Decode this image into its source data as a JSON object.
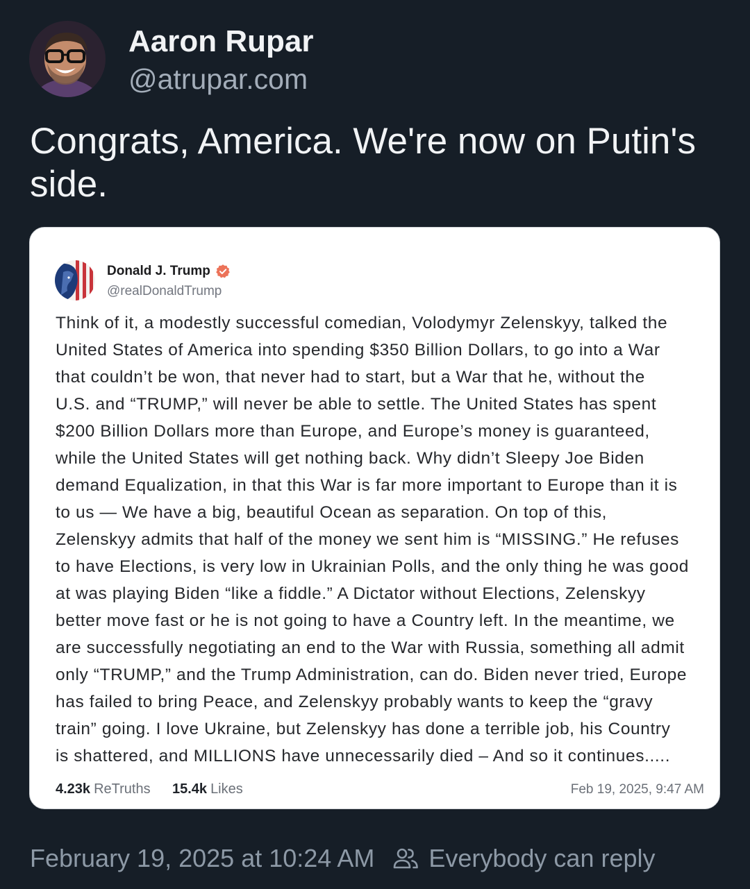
{
  "post": {
    "author_name": "Aaron Rupar",
    "author_handle": "@atrupar.com",
    "text": "Congrats, America. We're now on Putin's side.",
    "timestamp": "February 19, 2025 at 10:24 AM",
    "reply_setting": "Everybody can reply"
  },
  "embedded_screenshot": {
    "author_name": "Donald J. Trump",
    "author_handle": "@realDonaldTrump",
    "verified": true,
    "body_lines": [
      "Think of it, a modestly successful comedian, Volodymyr Zelenskyy, talked the",
      "United States of America into spending $350 Billion Dollars, to go into a War",
      "that couldn’t be won, that never had to start, but a War that he, without the",
      "U.S. and “TRUMP,” will never be able to settle. The United States has spent",
      "$200 Billion Dollars more than Europe, and Europe’s money is guaranteed,",
      "while the United States will get nothing back. Why didn’t Sleepy Joe Biden",
      "demand Equalization, in that this War is far more important to Europe than it is",
      "to us — We have a big, beautiful Ocean as separation. On top of this,",
      "Zelenskyy admits that half of the money we sent him is “MISSING.” He refuses",
      "to have Elections, is very low in Ukrainian Polls, and the only thing he was good",
      "at was playing Biden “like a fiddle.” A Dictator without Elections, Zelenskyy",
      "better move fast or he is not going to have a Country left. In the meantime, we",
      "are successfully negotiating an end to the War with Russia, something all admit",
      "only “TRUMP,” and the Trump Administration, can do. Biden never tried, Europe",
      "has failed to bring Peace, and Zelenskyy probably wants to keep the “gravy",
      "train” going. I love Ukraine, but Zelenskyy has done a terrible job, his Country",
      "is shattered, and MILLIONS have unnecessarily died – And so it continues....."
    ],
    "retruths_count": "4.23k",
    "retruths_label": "ReTruths",
    "likes_count": "15.4k",
    "likes_label": "Likes",
    "timestamp": "Feb 19, 2025, 9:47 AM"
  },
  "icons": {
    "author_avatar": "avatar-icon",
    "embedded_author_avatar": "avatar-icon",
    "verified_badge": "verified-badge-icon",
    "reply_setting": "people-icon"
  },
  "colors": {
    "background": "#161e27",
    "text": "#f1f3f5",
    "handle_text": "#a3adb9",
    "muted_text": "#8d99a6",
    "card_background": "#ffffff",
    "verified_badge": "#ec7359"
  }
}
